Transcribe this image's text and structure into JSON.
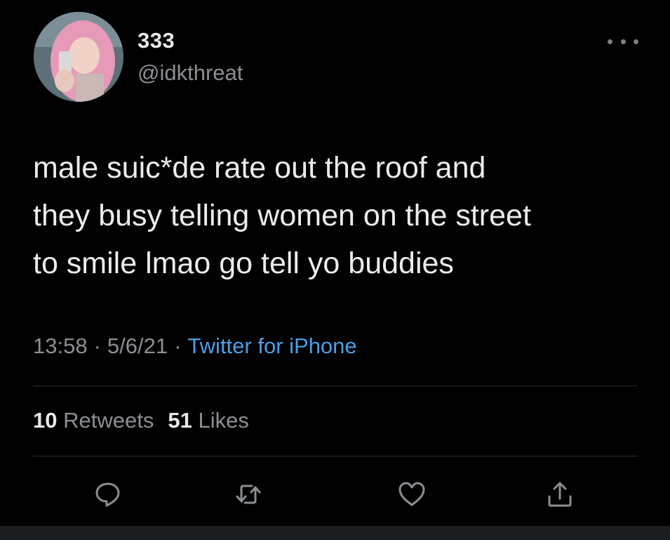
{
  "user": {
    "display_name": "333",
    "handle": "@idkthreat"
  },
  "tweet": {
    "lines": [
      "male suic*de rate out the roof and",
      "they busy telling women on the street",
      "to smile lmao go tell yo buddies"
    ],
    "time": "13:58",
    "date": "5/6/21",
    "separator": "·",
    "source": "Twitter for iPhone"
  },
  "stats": {
    "retweets_count": "10",
    "retweets_label": "Retweets",
    "likes_count": "51",
    "likes_label": "Likes"
  },
  "actions": [
    {
      "icon": "reply-icon"
    },
    {
      "icon": "retweet-icon"
    },
    {
      "icon": "like-icon"
    },
    {
      "icon": "share-icon"
    }
  ],
  "colors": {
    "background": "#000000",
    "primary_text": "#e7e9ea",
    "secondary_text": "#8b8f94",
    "link": "#4b9fe6",
    "divider": "#2a2d31"
  }
}
